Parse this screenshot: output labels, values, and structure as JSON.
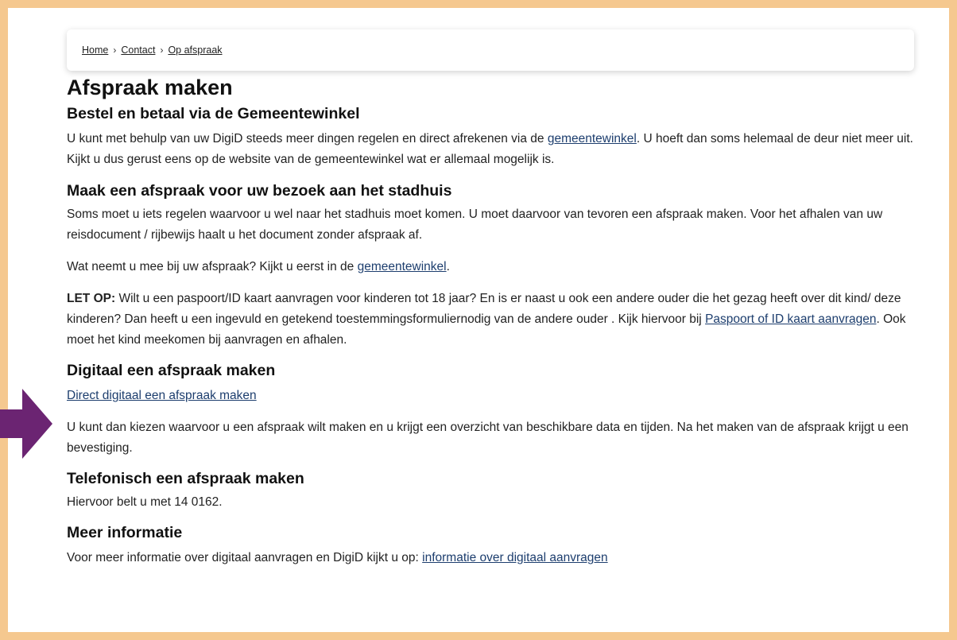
{
  "breadcrumb": {
    "home": "Home",
    "contact": "Contact",
    "current": "Op afspraak",
    "separator": "›"
  },
  "page_title": "Afspraak maken",
  "section1": {
    "title": "Bestel en betaal via de Gemeentewinkel",
    "text_before": "U kunt met behulp van uw DigiD steeds meer dingen regelen en direct afrekenen via de ",
    "link": "gemeentewinkel",
    "text_after": ". U hoeft dan soms helemaal de deur niet meer uit. Kijkt u dus gerust eens op de website van de gemeentewinkel  wat er allemaal mogelijk is."
  },
  "section2": {
    "title": "Maak een afspraak voor uw bezoek aan het stadhuis",
    "para1": "Soms moet u iets regelen waarvoor u wel naar het stadhuis moet komen. U moet daarvoor van tevoren een afspraak maken. Voor het afhalen van uw reisdocument / rijbewijs haalt u het document zonder afspraak af.",
    "para2_before": "Wat neemt u mee bij uw afspraak? Kijkt u eerst in de ",
    "para2_link": "gemeentewinkel",
    "para2_after": ".",
    "para3_bold": "LET OP:",
    "para3_text": " Wilt u een paspoort/ID kaart aanvragen voor kinderen tot 18 jaar? En is er naast u ook een andere ouder die het gezag heeft over dit kind/ deze kinderen?  Dan heeft u  een ingevuld en getekend toestemmingsformuliernodig van de andere ouder . Kijk hiervoor bij ",
    "para3_link": "Paspoort of ID kaart aanvragen",
    "para3_after": ". Ook moet het kind meekomen bij aanvragen en afhalen."
  },
  "section3": {
    "title": "Digitaal een afspraak maken",
    "link": "Direct digitaal een afspraak maken",
    "text": "U kunt dan kiezen waarvoor u een afspraak wilt maken en u krijgt een overzicht van beschikbare data en tijden. Na het maken van de afspraak krijgt u een bevestiging."
  },
  "section4": {
    "title": "Telefonisch een afspraak maken",
    "text": "Hiervoor belt u met 14 0162."
  },
  "section5": {
    "title": "Meer informatie",
    "text_before": "Voor meer informatie over digitaal aanvragen en DigiD kijkt u op: ",
    "link": "informatie over digitaal aanvragen"
  },
  "colors": {
    "frame": "#f5c88f",
    "arrow": "#6b2472",
    "link": "#1d3e6e"
  }
}
